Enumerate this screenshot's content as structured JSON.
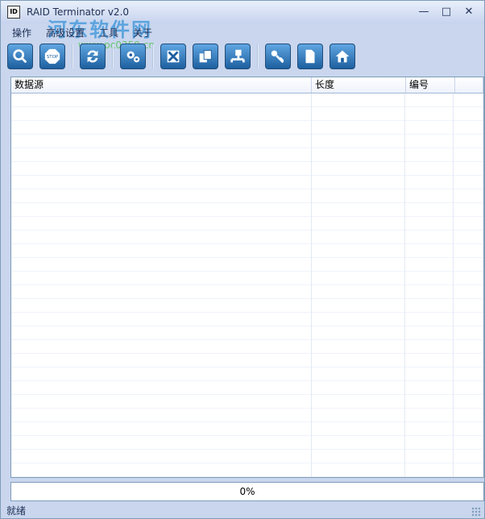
{
  "window": {
    "title": "RAID Terminator v2.0"
  },
  "watermark": {
    "brand": "河东软件网",
    "site": "www.pc0359.cn"
  },
  "menu": [
    "操作",
    "高级设置",
    "工具",
    "关于"
  ],
  "toolbar": {
    "buttons": [
      {
        "icon": "search-icon"
      },
      {
        "icon": "stop-icon"
      },
      {
        "icon": "refresh-icon"
      },
      {
        "icon": "settings-icon"
      },
      {
        "icon": "disk-x-icon"
      },
      {
        "icon": "copy-icon"
      },
      {
        "icon": "network-icon"
      },
      {
        "icon": "key-icon"
      },
      {
        "icon": "file-icon"
      },
      {
        "icon": "home-icon"
      }
    ]
  },
  "table": {
    "columns": [
      "数据源",
      "长度",
      "编号",
      ""
    ]
  },
  "progress": {
    "value": 0,
    "label": "0%"
  },
  "status": {
    "text": "就绪"
  }
}
